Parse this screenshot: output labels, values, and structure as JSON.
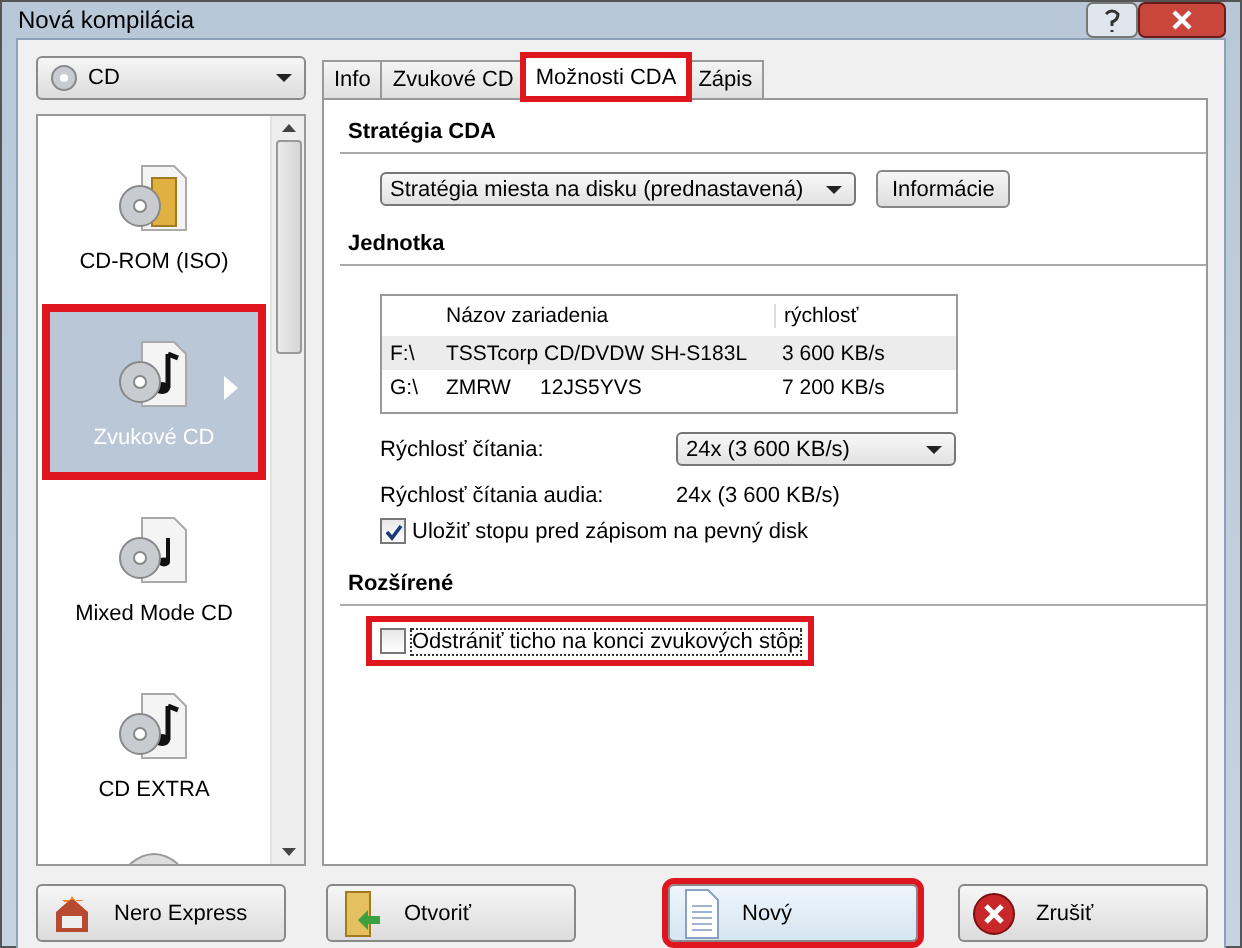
{
  "window": {
    "title": "Nová kompilácia"
  },
  "disc_type": {
    "value": "CD"
  },
  "project_types": [
    {
      "label": "CD-ROM (ISO)",
      "kind": "folder",
      "selected": false,
      "highlighted": false
    },
    {
      "label": "Zvukové CD",
      "kind": "music",
      "selected": true,
      "highlighted": true
    },
    {
      "label": "Mixed Mode CD",
      "kind": "mixed",
      "selected": false,
      "highlighted": false
    },
    {
      "label": "CD EXTRA",
      "kind": "extra",
      "selected": false,
      "highlighted": false
    }
  ],
  "tabs": [
    {
      "label": "Info",
      "selected": false,
      "highlighted": false
    },
    {
      "label": "Zvukové CD",
      "selected": false,
      "highlighted": false
    },
    {
      "label": "Možnosti CDA",
      "selected": true,
      "highlighted": true
    },
    {
      "label": "Zápis",
      "selected": false,
      "highlighted": false
    }
  ],
  "strategy": {
    "heading": "Stratégia CDA",
    "select_value": "Stratégia miesta na disku (prednastavená)",
    "info_button": "Informácie"
  },
  "drive": {
    "heading": "Jednotka",
    "columns": [
      "Názov zariadenia",
      "rýchlosť"
    ],
    "rows": [
      {
        "letter": "F:\\",
        "name": "TSSTcorp CD/DVDW SH-S183L",
        "speed": "3 600 KB/s",
        "selected": true
      },
      {
        "letter": "G:\\",
        "name": "ZMRW     12JS5YVS",
        "speed": "7 200 KB/s",
        "selected": false
      }
    ],
    "read_speed": {
      "label": "Rýchlosť čítania:",
      "value": "24x (3 600 KB/s)"
    },
    "audio_read_speed": {
      "label": "Rýchlosť čítania audia:",
      "value": "24x (3 600 KB/s)"
    },
    "save_track": {
      "label": "Uložiť stopu pred zápisom na pevný disk",
      "checked": true
    }
  },
  "advanced": {
    "heading": "Rozšírené",
    "remove_silence": {
      "label": "Odstrániť ticho na konci zvukových stôp",
      "checked": false,
      "highlighted": true
    }
  },
  "buttons": [
    {
      "label": "Nero Express",
      "kind": "express",
      "highlighted": false
    },
    {
      "label": "Otvoriť",
      "kind": "open",
      "highlighted": false
    },
    {
      "label": "Nový",
      "kind": "new",
      "highlighted": true
    },
    {
      "label": "Zrušiť",
      "kind": "cancel",
      "highlighted": false
    }
  ]
}
